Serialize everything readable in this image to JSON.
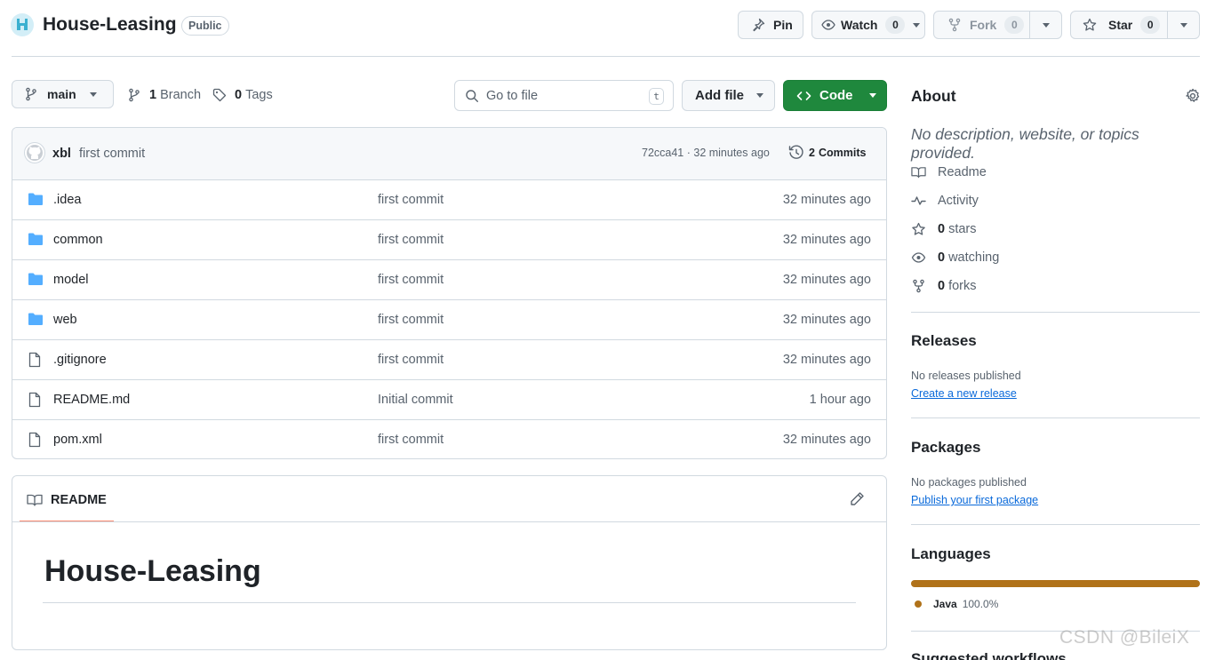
{
  "repo": {
    "name": "House-Leasing",
    "visibility": "Public"
  },
  "header_actions": {
    "pin_label": "Pin",
    "watch_label": "Watch",
    "watch_count": "0",
    "fork_label": "Fork",
    "fork_count": "0",
    "star_label": "Star",
    "star_count": "0"
  },
  "toolbar": {
    "branch": "main",
    "branches_count": "1",
    "branches_label": "Branch",
    "tags_count": "0",
    "tags_label": "Tags",
    "search_placeholder": "Go to file",
    "search_shortcut": "t",
    "add_file_label": "Add file",
    "code_label": "Code"
  },
  "commit": {
    "author": "xbl",
    "message": "first commit",
    "hash_time": "72cca41 · 32 minutes ago",
    "commits_count": "2",
    "commits_label": "Commits"
  },
  "files": [
    {
      "type": "folder",
      "name": ".idea",
      "message": "first commit",
      "time": "32 minutes ago"
    },
    {
      "type": "folder",
      "name": "common",
      "message": "first commit",
      "time": "32 minutes ago"
    },
    {
      "type": "folder",
      "name": "model",
      "message": "first commit",
      "time": "32 minutes ago"
    },
    {
      "type": "folder",
      "name": "web",
      "message": "first commit",
      "time": "32 minutes ago"
    },
    {
      "type": "file",
      "name": ".gitignore",
      "message": "first commit",
      "time": "32 minutes ago"
    },
    {
      "type": "file",
      "name": "README.md",
      "message": "Initial commit",
      "time": "1 hour ago"
    },
    {
      "type": "file",
      "name": "pom.xml",
      "message": "first commit",
      "time": "32 minutes ago"
    }
  ],
  "readme": {
    "tab_label": "README",
    "heading": "House-Leasing"
  },
  "about": {
    "title": "About",
    "description": "No description, website, or topics provided.",
    "readme": "Readme",
    "activity": "Activity",
    "stars_count": "0",
    "stars_label": "stars",
    "watching_count": "0",
    "watching_label": "watching",
    "forks_count": "0",
    "forks_label": "forks"
  },
  "releases": {
    "title": "Releases",
    "empty_text": "No releases published",
    "create_link": "Create a new release"
  },
  "packages": {
    "title": "Packages",
    "empty_text": "No packages published",
    "publish_link": "Publish your first package"
  },
  "languages": {
    "title": "Languages",
    "items": [
      {
        "name": "Java",
        "percent": "100.0%",
        "fraction": 1.0,
        "color": "#b07219"
      }
    ]
  },
  "suggested": {
    "title": "Suggested workflows"
  },
  "watermark": "CSDN @BileiX",
  "colors": {
    "primary_green": "#1f883d",
    "folder_blue": "#54aeff",
    "link_blue": "#0969da",
    "readme_tab_accent": "#fd8c73"
  }
}
